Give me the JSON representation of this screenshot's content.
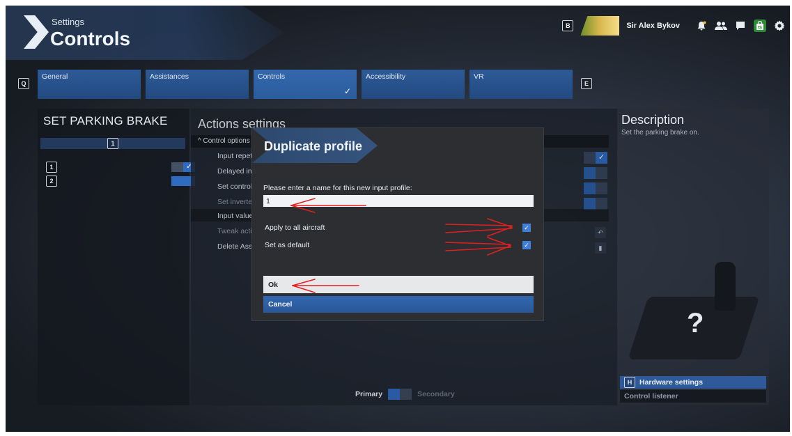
{
  "header": {
    "section": "Settings",
    "page": "Controls"
  },
  "topbar": {
    "key_b": "B",
    "user_name": "Sir Alex Bykov",
    "shop_label": "fS"
  },
  "tabs": {
    "key_left": "Q",
    "key_right": "E",
    "items": [
      {
        "label": "General"
      },
      {
        "label": "Assistances"
      },
      {
        "label": "Controls"
      },
      {
        "label": "Accessibility"
      },
      {
        "label": "VR"
      }
    ],
    "active_check": "✓"
  },
  "left_panel": {
    "title": "SET PARKING BRAKE",
    "binding_header_key": "1",
    "rows": [
      {
        "key": "1"
      },
      {
        "key": "2"
      }
    ],
    "check": "✓"
  },
  "center_panel": {
    "title": "Actions settings",
    "section_header": "Control options",
    "rows": [
      {
        "label": "Input repetit"
      },
      {
        "label": "Delayed inpu"
      },
      {
        "label": "Set control c"
      },
      {
        "label": "Set inverted"
      },
      {
        "label": "Input value"
      },
      {
        "label": "Tweak actio"
      },
      {
        "label": "Delete Assig"
      }
    ],
    "primary_label": "Primary",
    "secondary_label": "Secondary"
  },
  "right_panel": {
    "title": "Description",
    "description": "Set the parking brake on.",
    "placeholder_glyph": "?",
    "hardware_key": "H",
    "hardware_label": "Hardware settings",
    "listener_label": "Control listener"
  },
  "dialog": {
    "title": "Duplicate profile",
    "prompt": "Please enter a name for this new input profile:",
    "input_value": "1",
    "apply_all_label": "Apply to all aircraft",
    "apply_all_checked": true,
    "default_label": "Set as default",
    "default_checked": true,
    "check_glyph": "✓",
    "ok_label": "Ok",
    "cancel_label": "Cancel"
  },
  "colors": {
    "accent_blue": "#2f6bc1",
    "tab_blue": "#224a80",
    "dialog_bg": "#2c2e31",
    "annotation_red": "#e02020",
    "shop_green": "#2d8a35"
  },
  "icons": [
    "bell-icon",
    "friends-icon",
    "chat-icon",
    "shop-icon",
    "gear-icon",
    "chevron-up-icon",
    "trash-icon",
    "reset-icon"
  ]
}
